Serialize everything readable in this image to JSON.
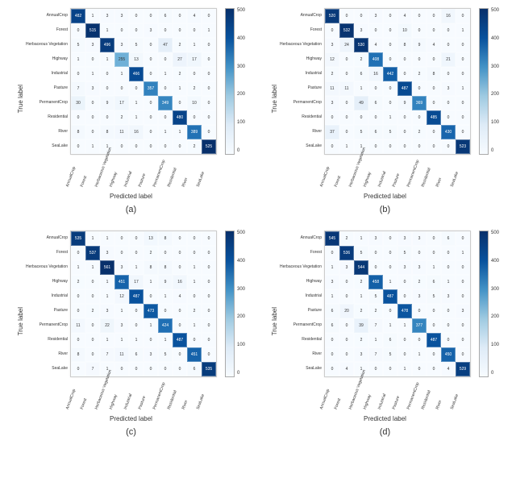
{
  "categories": [
    "AnnualCrop",
    "Forest",
    "Herbaceous Vegetation",
    "Highway",
    "Industrial",
    "Pasture",
    "PermanentCrop",
    "Residential",
    "River",
    "SeaLake"
  ],
  "ylabel": "True label",
  "xlabel": "Predicted label",
  "cb_ticks": [
    "500",
    "400",
    "300",
    "200",
    "100",
    "0"
  ],
  "subcaps": [
    "(a)",
    "(b)",
    "(c)",
    "(d)"
  ],
  "chart_data": [
    {
      "type": "heatmap",
      "title": "",
      "xlabel": "Predicted label",
      "ylabel": "True label",
      "categories": [
        "AnnualCrop",
        "Forest",
        "Herbaceous Vegetation",
        "Highway",
        "Industrial",
        "Pasture",
        "PermanentCrop",
        "Residential",
        "River",
        "SeaLake"
      ],
      "vmin": 0,
      "vmax": 520,
      "matrix": [
        [
          482,
          1,
          3,
          3,
          0,
          0,
          6,
          0,
          4,
          0
        ],
        [
          0,
          515,
          1,
          0,
          0,
          3,
          0,
          0,
          0,
          1
        ],
        [
          5,
          3,
          496,
          3,
          5,
          0,
          47,
          2,
          1,
          0
        ],
        [
          1,
          0,
          1,
          255,
          13,
          0,
          0,
          27,
          17,
          0
        ],
        [
          0,
          1,
          0,
          1,
          466,
          0,
          1,
          2,
          0,
          0
        ],
        [
          7,
          3,
          0,
          0,
          0,
          357,
          0,
          1,
          2,
          0
        ],
        [
          30,
          0,
          9,
          17,
          1,
          0,
          349,
          0,
          10,
          0
        ],
        [
          0,
          0,
          0,
          2,
          1,
          0,
          0,
          480,
          0,
          0
        ],
        [
          8,
          0,
          8,
          11,
          16,
          0,
          1,
          1,
          389,
          0
        ],
        [
          0,
          1,
          1,
          0,
          0,
          0,
          0,
          0,
          2,
          525
        ]
      ]
    },
    {
      "type": "heatmap",
      "title": "",
      "xlabel": "Predicted label",
      "ylabel": "True label",
      "categories": [
        "AnnualCrop",
        "Forest",
        "Herbaceous Vegetation",
        "Highway",
        "Industrial",
        "Pasture",
        "PermanentCrop",
        "Residential",
        "River",
        "SeaLake"
      ],
      "vmin": 0,
      "vmax": 540,
      "matrix": [
        [
          520,
          0,
          0,
          3,
          0,
          4,
          0,
          0,
          16,
          0
        ],
        [
          0,
          532,
          3,
          0,
          0,
          10,
          0,
          0,
          0,
          1
        ],
        [
          3,
          24,
          530,
          4,
          0,
          8,
          9,
          4,
          0,
          0
        ],
        [
          12,
          0,
          2,
          408,
          0,
          0,
          0,
          0,
          21,
          0
        ],
        [
          2,
          0,
          6,
          16,
          442,
          0,
          2,
          8,
          0,
          0
        ],
        [
          11,
          11,
          1,
          0,
          0,
          487,
          0,
          0,
          3,
          1
        ],
        [
          3,
          0,
          49,
          6,
          0,
          9,
          369,
          0,
          0,
          0
        ],
        [
          0,
          0,
          0,
          0,
          1,
          0,
          0,
          485,
          0,
          0
        ],
        [
          37,
          0,
          5,
          6,
          5,
          0,
          2,
          0,
          430,
          0
        ],
        [
          0,
          1,
          1,
          0,
          0,
          0,
          0,
          0,
          0,
          523
        ]
      ]
    },
    {
      "type": "heatmap",
      "title": "",
      "xlabel": "Predicted label",
      "ylabel": "True label",
      "categories": [
        "AnnualCrop",
        "Forest",
        "Herbaceous Vegetation",
        "Highway",
        "Industrial",
        "Pasture",
        "PermanentCrop",
        "Residential",
        "River",
        "SeaLake"
      ],
      "vmin": 0,
      "vmax": 560,
      "matrix": [
        [
          535,
          1,
          1,
          0,
          0,
          13,
          8,
          0,
          0,
          0
        ],
        [
          0,
          537,
          3,
          0,
          0,
          2,
          0,
          0,
          0,
          0
        ],
        [
          1,
          1,
          561,
          3,
          1,
          8,
          8,
          0,
          1,
          0
        ],
        [
          2,
          0,
          1,
          451,
          17,
          1,
          9,
          16,
          1,
          0
        ],
        [
          0,
          0,
          1,
          12,
          487,
          0,
          1,
          4,
          0,
          0
        ],
        [
          0,
          2,
          3,
          1,
          0,
          473,
          0,
          0,
          2,
          0
        ],
        [
          11,
          0,
          22,
          3,
          0,
          1,
          424,
          0,
          1,
          0
        ],
        [
          0,
          0,
          1,
          1,
          1,
          0,
          1,
          487,
          0,
          0
        ],
        [
          8,
          0,
          7,
          11,
          6,
          3,
          5,
          0,
          451,
          0
        ],
        [
          0,
          7,
          1,
          0,
          0,
          0,
          0,
          0,
          6,
          535
        ]
      ]
    },
    {
      "type": "heatmap",
      "title": "",
      "xlabel": "Predicted label",
      "ylabel": "True label",
      "categories": [
        "AnnualCrop",
        "Forest",
        "Herbaceous Vegetation",
        "Highway",
        "Industrial",
        "Pasture",
        "PermanentCrop",
        "Residential",
        "River",
        "SeaLake"
      ],
      "vmin": 0,
      "vmax": 560,
      "matrix": [
        [
          545,
          2,
          1,
          3,
          0,
          3,
          3,
          0,
          6,
          0
        ],
        [
          0,
          536,
          5,
          0,
          0,
          5,
          0,
          0,
          0,
          1
        ],
        [
          1,
          3,
          544,
          0,
          0,
          3,
          3,
          1,
          0,
          0
        ],
        [
          3,
          0,
          2,
          458,
          1,
          0,
          2,
          6,
          1,
          0
        ],
        [
          1,
          0,
          1,
          5,
          487,
          0,
          3,
          5,
          3,
          0
        ],
        [
          6,
          20,
          2,
          2,
          0,
          478,
          0,
          0,
          0,
          3
        ],
        [
          6,
          0,
          39,
          7,
          1,
          1,
          377,
          0,
          0,
          0
        ],
        [
          0,
          0,
          2,
          1,
          6,
          0,
          0,
          487,
          0,
          0
        ],
        [
          0,
          0,
          3,
          7,
          5,
          0,
          1,
          0,
          450,
          0
        ],
        [
          0,
          4,
          1,
          0,
          0,
          1,
          0,
          0,
          4,
          529
        ]
      ]
    }
  ]
}
